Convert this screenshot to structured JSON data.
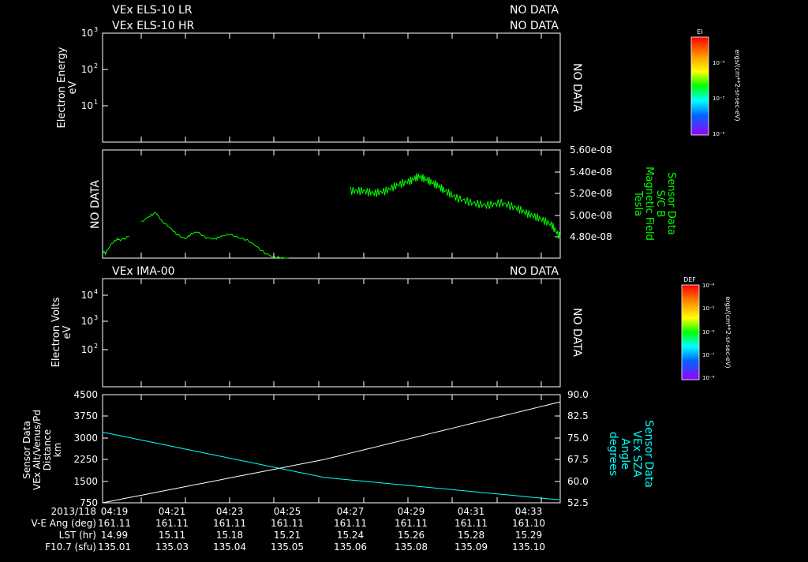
{
  "colors": {
    "background": "#000000",
    "axes": "#ffffff",
    "magnetic": "#00ff00",
    "sza": "#00ffff",
    "altitude": "#ffffff"
  },
  "no_data_text": "NO DATA",
  "panel1": {
    "line1": "VEx ELS-10 LR",
    "line2": "VEx ELS-10 HR",
    "status1": "NO DATA",
    "status2": "NO DATA",
    "ylabel1": "Electron Energy",
    "ylabel2": "eV",
    "ticks": [
      {
        "base": "10",
        "exp": "3"
      },
      {
        "base": "10",
        "exp": "2"
      },
      {
        "base": "10",
        "exp": "1"
      }
    ],
    "colorbar": {
      "title": "EI",
      "labels": [
        "10⁻⁴",
        "10⁻⁵",
        "10⁻⁶"
      ],
      "unit": "ergs/(cm**2-sr-sec-eV)"
    }
  },
  "panel2": {
    "ylabels": [
      "Sensor Data",
      "S/C B",
      "Magnetic Field",
      "Tesla"
    ],
    "ticks": [
      "5.60e-08",
      "5.40e-08",
      "5.20e-08",
      "5.00e-08",
      "4.80e-08"
    ]
  },
  "panel3": {
    "title": "VEx IMA-00",
    "status": "NO DATA",
    "ylabel1": "Electron Volts",
    "ylabel2": "eV",
    "ticks": [
      {
        "base": "10",
        "exp": "4"
      },
      {
        "base": "10",
        "exp": "3"
      },
      {
        "base": "10",
        "exp": "2"
      }
    ],
    "colorbar": {
      "title": "DEF",
      "labels": [
        "10⁻⁴",
        "10⁻⁵",
        "10⁻⁶",
        "10⁻⁷",
        "10⁻⁸"
      ],
      "unit": "ergs/(cm**2-sr-sec-eV)"
    }
  },
  "panel4": {
    "left_labels": [
      "Sensor Data",
      "VEx Alt/Venus/Pd",
      "Distance",
      "km"
    ],
    "right_labels": [
      "Sensor Data",
      "VEx SZA",
      "Angle",
      "degrees"
    ],
    "left_ticks": [
      "4500",
      "3750",
      "3000",
      "2250",
      "1500",
      "750"
    ],
    "right_ticks": [
      "90.0",
      "82.5",
      "75.0",
      "67.5",
      "60.0",
      "52.5"
    ]
  },
  "footer": {
    "row_labels": [
      "2013/118",
      "V-E Ang (deg)",
      "LST (hr)",
      "F10.7 (sfu)"
    ],
    "times": [
      "04:19",
      "04:21",
      "04:23",
      "04:25",
      "04:27",
      "04:29",
      "04:31",
      "04:33"
    ],
    "ve_ang": [
      "161.11",
      "161.11",
      "161.11",
      "161.11",
      "161.11",
      "161.11",
      "161.11",
      "161.10"
    ],
    "lst": [
      "14.99",
      "15.11",
      "15.18",
      "15.21",
      "15.24",
      "15.26",
      "15.28",
      "15.29"
    ],
    "f107": [
      "135.01",
      "135.03",
      "135.04",
      "135.05",
      "135.06",
      "135.08",
      "135.09",
      "135.10"
    ]
  },
  "chart_data": [
    {
      "type": "line",
      "panel": "magnetic_field",
      "ylim": [
        4.7e-08,
        5.6e-08
      ],
      "xlim": [
        0,
        15.5
      ],
      "series": [
        {
          "name": "S/C B",
          "segments": [
            [
              [
                0.0,
                4.76
              ],
              [
                0.1,
                4.74
              ],
              [
                0.3,
                4.82
              ],
              [
                0.5,
                4.86
              ],
              [
                0.6,
                4.85
              ],
              [
                0.9,
                4.88
              ]
            ],
            [
              [
                1.3,
                5.0
              ],
              [
                1.6,
                5.05
              ],
              [
                1.8,
                5.08
              ],
              [
                2.0,
                5.01
              ],
              [
                2.3,
                4.95
              ],
              [
                2.5,
                4.9
              ],
              [
                2.8,
                4.86
              ],
              [
                3.0,
                4.9
              ],
              [
                3.2,
                4.92
              ],
              [
                3.5,
                4.87
              ],
              [
                3.8,
                4.86
              ],
              [
                4.0,
                4.88
              ],
              [
                4.3,
                4.9
              ],
              [
                4.6,
                4.87
              ],
              [
                4.9,
                4.85
              ],
              [
                5.2,
                4.8
              ],
              [
                5.5,
                4.74
              ],
              [
                5.8,
                4.71
              ],
              [
                6.1,
                4.7
              ],
              [
                6.3,
                4.69
              ]
            ],
            [
              [
                8.4,
                5.26
              ],
              [
                8.8,
                5.26
              ],
              [
                9.2,
                5.24
              ],
              [
                9.6,
                5.26
              ],
              [
                10.0,
                5.31
              ],
              [
                10.4,
                5.34
              ],
              [
                10.7,
                5.38
              ],
              [
                11.0,
                5.35
              ],
              [
                11.3,
                5.31
              ],
              [
                11.6,
                5.26
              ],
              [
                12.0,
                5.2
              ],
              [
                12.5,
                5.16
              ],
              [
                13.0,
                5.14
              ],
              [
                13.5,
                5.16
              ],
              [
                14.0,
                5.12
              ],
              [
                14.4,
                5.07
              ],
              [
                14.8,
                5.03
              ],
              [
                15.2,
                4.98
              ],
              [
                15.5,
                4.87
              ]
            ]
          ]
        }
      ]
    },
    {
      "type": "line",
      "panel": "altitude_sza",
      "x": [
        0,
        15.5
      ],
      "series": [
        {
          "name": "VEx Alt/Venus/Pd",
          "axis": "left",
          "ylim": [
            750,
            4500
          ],
          "values": [
            [
              0,
              750
            ],
            [
              7.5,
              2250
            ],
            [
              15.5,
              4250
            ]
          ]
        },
        {
          "name": "VEx SZA",
          "axis": "right",
          "ylim": [
            52.5,
            90.0
          ],
          "values": [
            [
              0,
              77.0
            ],
            [
              7.5,
              61.3
            ],
            [
              15.5,
              53.5
            ]
          ]
        }
      ]
    }
  ]
}
